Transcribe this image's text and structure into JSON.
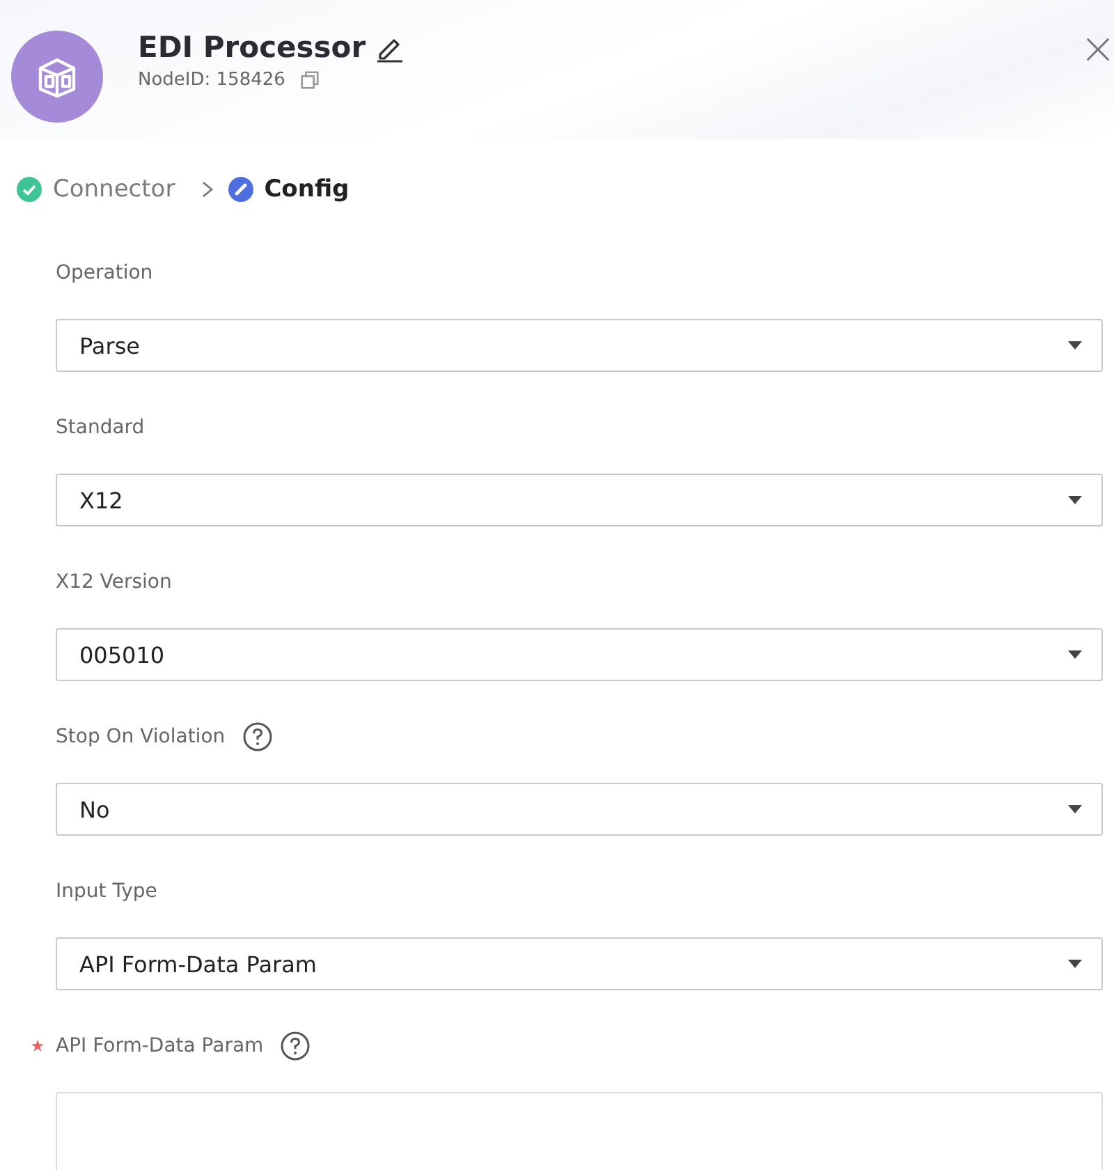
{
  "header": {
    "title": "EDI Processor",
    "node_id": "NodeID: 158426"
  },
  "steps": [
    {
      "label": "Connector",
      "kind": "done"
    },
    {
      "label": "Config",
      "kind": "active"
    }
  ],
  "fields": [
    {
      "kind": "select",
      "label": "Operation",
      "value": "Parse",
      "required": false,
      "help": false
    },
    {
      "kind": "select",
      "label": "Standard",
      "value": "X12",
      "required": false,
      "help": false
    },
    {
      "kind": "select",
      "label": "X12 Version",
      "value": "005010",
      "required": false,
      "help": false
    },
    {
      "kind": "select",
      "label": "Stop On Violation",
      "value": "No",
      "required": false,
      "help": true
    },
    {
      "kind": "select",
      "label": "Input Type",
      "value": "API Form-Data Param",
      "required": false,
      "help": false
    },
    {
      "kind": "text",
      "label": "API Form-Data Param",
      "required": true,
      "help": true
    }
  ]
}
